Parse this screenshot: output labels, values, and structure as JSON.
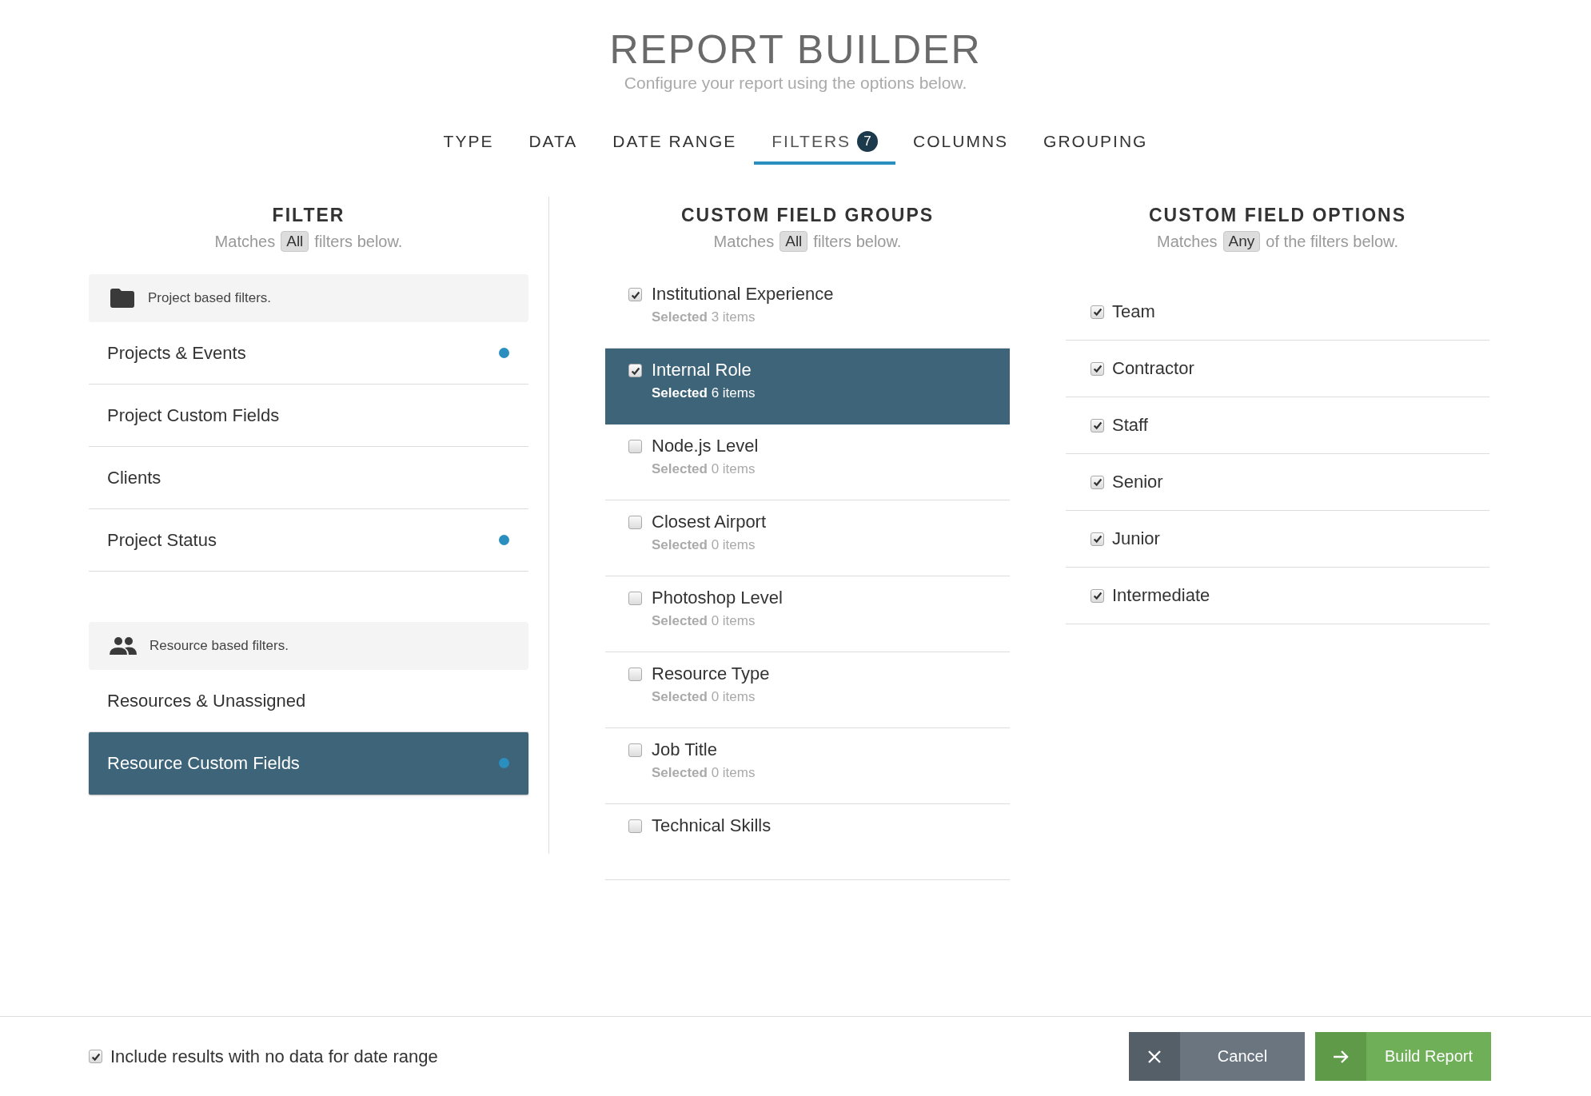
{
  "header": {
    "title": "REPORT BUILDER",
    "subtitle": "Configure your report using the options below."
  },
  "tabs": [
    {
      "label": "TYPE",
      "selected": false
    },
    {
      "label": "DATA",
      "selected": false
    },
    {
      "label": "DATE RANGE",
      "selected": false
    },
    {
      "label": "FILTERS",
      "selected": true,
      "badge": "7"
    },
    {
      "label": "COLUMNS",
      "selected": false
    },
    {
      "label": "GROUPING",
      "selected": false
    }
  ],
  "filter": {
    "heading": "FILTER",
    "matches": {
      "prefix": "Matches",
      "value": "All",
      "suffix": "filters below."
    },
    "sections": [
      {
        "kind": "folder",
        "label": "Project based filters.",
        "items": [
          {
            "label": "Projects & Events",
            "marked": true,
            "selected": false
          },
          {
            "label": "Project Custom Fields",
            "marked": false,
            "selected": false
          },
          {
            "label": "Clients",
            "marked": false,
            "selected": false
          },
          {
            "label": "Project Status",
            "marked": true,
            "selected": false
          }
        ]
      },
      {
        "kind": "people",
        "label": "Resource based filters.",
        "items": [
          {
            "label": "Resources & Unassigned",
            "marked": false,
            "selected": false
          },
          {
            "label": "Resource Custom Fields",
            "marked": true,
            "selected": true
          }
        ]
      }
    ]
  },
  "custom_field_groups": {
    "heading": "CUSTOM FIELD GROUPS",
    "matches": {
      "prefix": "Matches",
      "value": "All",
      "suffix": "filters below."
    },
    "items": [
      {
        "label": "Institutional Experience",
        "summary": "**Selected** 3 items",
        "checked": true,
        "selected": false
      },
      {
        "label": "Internal Role",
        "summary": "**Selected** 6 items",
        "checked": true,
        "selected": true
      },
      {
        "label": "Node.js Level",
        "summary": "**Selected** 0 items",
        "checked": false,
        "selected": false
      },
      {
        "label": "Closest Airport",
        "summary": "**Selected** 0 items",
        "checked": false,
        "selected": false
      },
      {
        "label": "Photoshop Level",
        "summary": "**Selected** 0 items",
        "checked": false,
        "selected": false
      },
      {
        "label": "Resource Type",
        "summary": "**Selected** 0 items",
        "checked": false,
        "selected": false
      },
      {
        "label": "Job Title",
        "summary": "**Selected** 0 items",
        "checked": false,
        "selected": false
      },
      {
        "label": "Technical Skills",
        "checked": false,
        "selected": false
      }
    ]
  },
  "custom_field_options": {
    "heading": "CUSTOM FIELD OPTIONS",
    "matches": {
      "prefix": "Matches",
      "value": "Any",
      "suffix": "of the filters below."
    },
    "items": [
      {
        "label": "Team",
        "checked": true
      },
      {
        "label": "Contractor",
        "checked": true
      },
      {
        "label": "Staff",
        "checked": true
      },
      {
        "label": "Senior",
        "checked": true
      },
      {
        "label": "Junior",
        "checked": true
      },
      {
        "label": "Intermediate",
        "checked": true
      }
    ]
  },
  "footer": {
    "include_empty": {
      "label": "Include results with no data for date range",
      "checked": true
    },
    "buttons": [
      {
        "kind": "cancel",
        "label": "Cancel"
      },
      {
        "kind": "build",
        "label": "Build Report"
      }
    ]
  }
}
